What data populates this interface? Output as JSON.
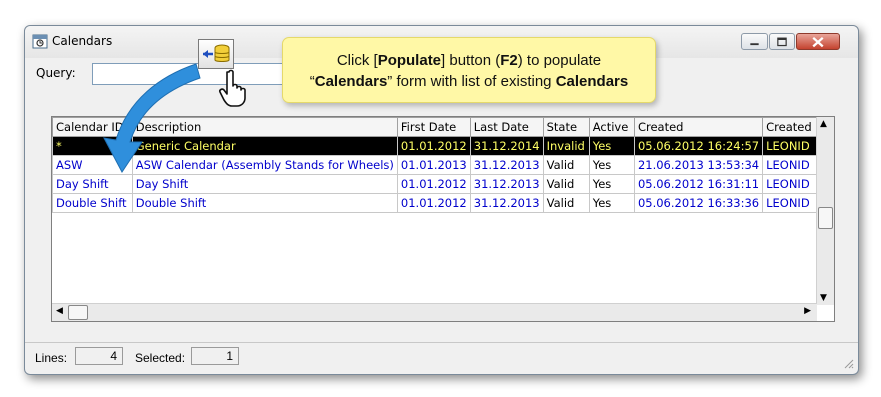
{
  "window": {
    "title": "Calendars"
  },
  "query": {
    "label": "Query:",
    "value": ""
  },
  "tooltip": {
    "line1_pre": "Click [",
    "line1_bold": "Populate",
    "line1_mid": "] button (",
    "line1_key": "F2",
    "line1_post": ") to populate",
    "line2_pre": "“",
    "line2_bold1": "Calendars",
    "line2_mid": "” form with list of existing ",
    "line2_bold2": "Calendars"
  },
  "columns": [
    "Calendar ID",
    "Description",
    "First Date",
    "Last Date",
    "State",
    "Active",
    "Created",
    "Created By"
  ],
  "rows": [
    [
      "*",
      "Generic Calendar",
      "01.01.2012",
      "31.12.2014",
      "Invalid",
      "Yes",
      "05.06.2012 16:24:57",
      "LEONID"
    ],
    [
      "ASW",
      "ASW Calendar (Assembly Stands for Wheels)",
      "01.01.2013",
      "31.12.2013",
      "Valid",
      "Yes",
      "21.06.2013 13:53:34",
      "LEONID"
    ],
    [
      "Day Shift",
      "Day Shift",
      "01.01.2012",
      "31.12.2013",
      "Valid",
      "Yes",
      "05.06.2012 16:31:11",
      "LEONID"
    ],
    [
      "Double Shift",
      "Double Shift",
      "01.01.2012",
      "31.12.2013",
      "Valid",
      "Yes",
      "05.06.2012 16:33:36",
      "LEONID"
    ]
  ],
  "status": {
    "lines_label": "Lines:",
    "lines_value": "4",
    "selected_label": "Selected:",
    "selected_value": "1"
  },
  "colors": {
    "selected_bg": "#000000",
    "selected_fg": "#ffff66",
    "link_text": "#0000cc",
    "tooltip_bg": "#fff8a6",
    "arrow": "#2f8fdc"
  },
  "icons": [
    "calendars-app-icon",
    "populate-icon",
    "hand-pointer-icon",
    "minimize-icon",
    "maximize-icon",
    "close-icon",
    "curved-arrow-icon"
  ]
}
